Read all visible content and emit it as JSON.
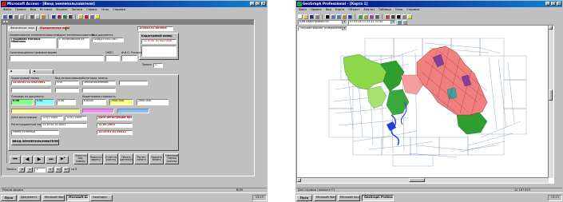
{
  "access": {
    "title": "Microsoft Access - [Ввод землепользователя]",
    "menu": [
      "Файл",
      "Правка",
      "Вид",
      "Вставка",
      "Формат",
      "Записи",
      "Сервис",
      "Окно",
      "Справка"
    ],
    "form": {
      "tab_labels": [
        "Физическое лицо",
        "Юридическое лицо"
      ],
      "header_code": "100440.01.000006",
      "cadastral_caption": "Кадастровый номер",
      "cadastral_value": "11:10:01 01 002:0001",
      "name_caption": "Наименование землепользователя",
      "name_value": "Гурьянова Наталья Ивановна",
      "address_caption": "Адрес землепользователя",
      "address_value": "с. Куликовское ул.",
      "doc_caption": "Вид документа",
      "doc_value": "СВИДЕТЕЛЬСТВО",
      "org_caption": "Организационно-правовая форма",
      "okpo_caption": "ОКПО",
      "fio_caption": "Ф.И.О. Русская",
      "zapis_caption": "Запись",
      "zapis_value": "1",
      "use_caption": "Вид использования",
      "use_value": "ЛПХ",
      "category_caption": "Категория земель",
      "category_value": "Земли поселений",
      "area_caption": "Площадь по документу",
      "area_value": "0.06",
      "price_caption": "Кадастровая стоимость",
      "price_value": "6.000р.",
      "price2_value": "2900.00р.",
      "date_caption": "Дата регистрации",
      "date_value": "12.07.2004",
      "date2_value": "12.07.2004",
      "reg_caption": "Регистрационный номер",
      "reg_value": "11:10:01 01 0001",
      "status_value": "Ранее учтенный",
      "red_caption": "Дата регистрации права",
      "red_value": "11.05.2005",
      "red_value2": "11:10:01 01 00312",
      "main_button": "ВВОД ЗЕМЛЕПОЛЬЗОВАТЕЛЯ",
      "buttons": [
        "Поиск по кад. номеру",
        "Поиск по адресу",
        "Отчет по участку",
        "Печать свидетельства",
        "Расчет налога",
        "Удалить запись",
        "Изменение границ участка"
      ],
      "nav_label": "Запись:",
      "nav_current": "1",
      "nav_total": "из 8"
    },
    "status_text": "Режим формы",
    "status_right": "NUM",
    "taskbar": {
      "start": "Пуск",
      "tasks": [
        "Документ1",
        "Microsoft Word",
        "Microsoft Access",
        "GeoGraph"
      ],
      "clock": "13:13"
    }
  },
  "geograph": {
    "title": "GeoGraph Professional - [Карта 1]",
    "menu": [
      "Файл",
      "Правка",
      "Вид",
      "Карта",
      "Объект",
      "Анализ",
      "Таблица",
      "Окно",
      "Справка"
    ],
    "combo1": "Дом кадастровой.nlb",
    "combo2": "07.05.04 11:33.22 33.44",
    "combo3": "Текущий формат отображения",
    "status_text": "Для справки нажмите F1",
    "status_coords": "12 187 823",
    "taskbar": {
      "start": "Пуск",
      "tasks": [
        "Microsoft Word",
        "Microsoft Access",
        "GeoGraph Professional"
      ],
      "clock": "13:13"
    },
    "colors": {
      "pink": "#f08080",
      "green": "#2e9e2e",
      "lime": "#8cd84a",
      "blue": "#1f3fd8",
      "purple": "#8040a0",
      "line": "#557799"
    }
  }
}
